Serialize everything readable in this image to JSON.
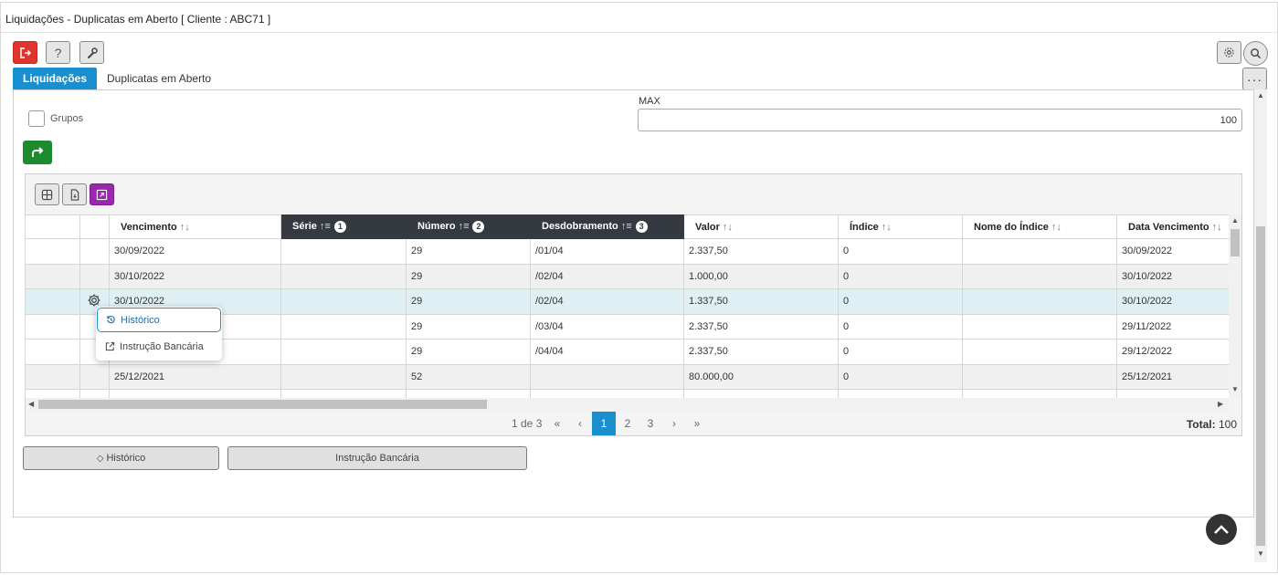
{
  "window": {
    "title": "Liquidações - Duplicatas em Aberto [ Cliente : ABC71 ]"
  },
  "toolbar": {
    "exit_icon": "exit-icon",
    "help_label": "?",
    "settings_icon": "wrench-icon"
  },
  "tabs": [
    {
      "label": "Liquidações",
      "active": true
    },
    {
      "label": "Duplicatas em Aberto",
      "active": false
    }
  ],
  "filters": {
    "groups_label": "Grupos",
    "max_label": "MAX",
    "max_value": "100"
  },
  "grid": {
    "columns": [
      {
        "label": "",
        "sorted": false
      },
      {
        "label": "",
        "sorted": false
      },
      {
        "label": "Vencimento",
        "sort_order": ""
      },
      {
        "label": "Série",
        "sort_order": "1"
      },
      {
        "label": "Número",
        "sort_order": "2"
      },
      {
        "label": "Desdobramento",
        "sort_order": "3"
      },
      {
        "label": "Valor",
        "sort_order": ""
      },
      {
        "label": "Índice",
        "sort_order": ""
      },
      {
        "label": "Nome do Índice",
        "sort_order": ""
      },
      {
        "label": "Data Vencimento",
        "sort_order": ""
      }
    ],
    "rows": [
      {
        "vencimento": "30/09/2022",
        "serie": "",
        "numero": "29",
        "desdobramento": "/01/04",
        "valor": "2.337,50",
        "indice": "0",
        "nome_indice": "",
        "data_vencimento": "30/09/2022"
      },
      {
        "vencimento": "30/10/2022",
        "serie": "",
        "numero": "29",
        "desdobramento": "/02/04",
        "valor": "1.000,00",
        "indice": "0",
        "nome_indice": "",
        "data_vencimento": "30/10/2022"
      },
      {
        "vencimento": "30/10/2022",
        "serie": "",
        "numero": "29",
        "desdobramento": "/02/04",
        "valor": "1.337,50",
        "indice": "0",
        "nome_indice": "",
        "data_vencimento": "30/10/2022"
      },
      {
        "vencimento": "",
        "serie": "",
        "numero": "29",
        "desdobramento": "/03/04",
        "valor": "2.337,50",
        "indice": "0",
        "nome_indice": "",
        "data_vencimento": "29/11/2022"
      },
      {
        "vencimento": "",
        "serie": "",
        "numero": "29",
        "desdobramento": "/04/04",
        "valor": "2.337,50",
        "indice": "0",
        "nome_indice": "",
        "data_vencimento": "29/12/2022"
      },
      {
        "vencimento": "25/12/2021",
        "serie": "",
        "numero": "52",
        "desdobramento": "",
        "valor": "80.000,00",
        "indice": "0",
        "nome_indice": "",
        "data_vencimento": "25/12/2021"
      }
    ],
    "selected_row": 2
  },
  "context_menu": {
    "items": [
      {
        "label": "Histórico",
        "icon": "history-icon"
      },
      {
        "label": "Instrução Bancária",
        "icon": "external-link-icon"
      }
    ]
  },
  "pagination": {
    "info": "1 de 3",
    "pages": [
      "1",
      "2",
      "3"
    ],
    "current": "1",
    "total_label": "Total:",
    "total_value": "100"
  },
  "actions": {
    "historico_label": "Histórico",
    "instrucao_label": "Instrução Bancária"
  }
}
